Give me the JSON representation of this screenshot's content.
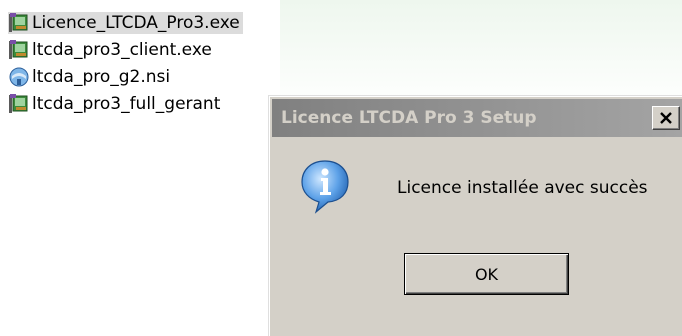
{
  "files": [
    {
      "label": "Licence_LTCDA_Pro3.exe",
      "icon": "installer-exe-icon",
      "selected": true
    },
    {
      "label": "ltcda_pro3_client.exe",
      "icon": "installer-exe-icon",
      "selected": false
    },
    {
      "label": "ltcda_pro_g2.nsi",
      "icon": "nsis-script-icon",
      "selected": false
    },
    {
      "label": "ltcda_pro3_full_gerant",
      "icon": "installer-exe-icon",
      "selected": false
    }
  ],
  "dialog": {
    "title": "Licence LTCDA Pro 3 Setup",
    "close_label": "X",
    "message": "Licence installée avec succès",
    "ok_label": "OK",
    "icon": "info-icon"
  },
  "colors": {
    "dialog_face": "#d4d0c8",
    "titlebar_inactive": "#808080",
    "info_blue": "#1f6fc8"
  }
}
